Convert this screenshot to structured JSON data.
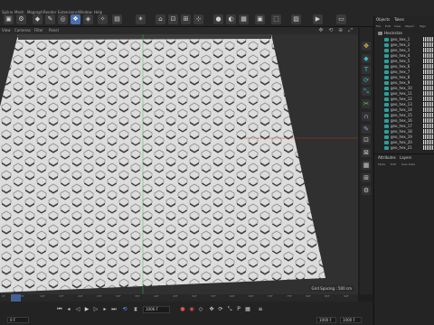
{
  "menubar": {
    "items": [
      "Spline",
      "Mesh",
      "Mograph",
      "Render",
      "Extensions",
      "Window",
      "Help"
    ]
  },
  "viewport": {
    "menu": [
      "View",
      "Cameras",
      "Filter",
      "Panel"
    ],
    "grid_spacing": "Grid Spacing : 500 cm",
    "colors": {
      "background": "#303030",
      "tile": "#e0e0e0",
      "axis_green": "#4caf50",
      "axis_red": "#c0392b"
    }
  },
  "objects_panel": {
    "tabs": [
      "Objects",
      "Takes"
    ],
    "menu": [
      "File",
      "Edit",
      "View",
      "Object",
      "Tags"
    ],
    "root": "Hexinstan",
    "items": [
      "geo_hex_1",
      "geo_hex_2",
      "geo_hex_3",
      "geo_hex_4",
      "geo_hex_5",
      "geo_hex_6",
      "geo_hex_7",
      "geo_hex_8",
      "geo_hex_9",
      "geo_hex_10",
      "geo_hex_11",
      "geo_hex_12",
      "geo_hex_13",
      "geo_hex_14",
      "geo_hex_15",
      "geo_hex_16",
      "geo_hex_17",
      "geo_hex_18",
      "geo_hex_19",
      "geo_hex_20",
      "geo_hex_21"
    ]
  },
  "attributes_panel": {
    "tabs": [
      "Attributes",
      "Layers"
    ],
    "menu": [
      "Mode",
      "Edit",
      "User Data"
    ]
  },
  "timeline": {
    "ticks": [
      "0F",
      "5F",
      "10F",
      "15F",
      "20F",
      "25F",
      "30F",
      "35F",
      "40F",
      "45F",
      "50F",
      "55F",
      "60F",
      "65F",
      "70F",
      "75F",
      "80F",
      "85F",
      "90F"
    ]
  },
  "transport": {
    "current_frame": "1006 F",
    "start_frame": "0 F",
    "end_frame": "1000 F",
    "max_frame": "1000 F"
  }
}
